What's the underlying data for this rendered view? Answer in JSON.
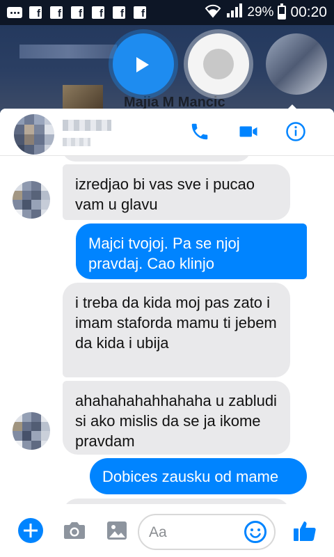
{
  "status_bar": {
    "notification_icons": [
      "messages-icon",
      "facebook-icon",
      "facebook-icon",
      "facebook-icon",
      "facebook-icon",
      "facebook-icon",
      "facebook-icon"
    ],
    "battery_percent": "29%",
    "time": "00:20"
  },
  "background": {
    "contact_name": "Majia M Mancic"
  },
  "chat_header": {
    "call_icon": "phone-icon",
    "video_icon": "video-camera-icon",
    "info_icon": "info-icon"
  },
  "messages": [
    {
      "direction": "incoming",
      "text": "izredjao bi vas sve i pucao vam u glavu"
    },
    {
      "direction": "outgoing",
      "text": "Majci tvojoj. Pa se njoj pravdaj. Cao klinjo"
    },
    {
      "direction": "incoming",
      "text": "i treba da kida moj pas zato i imam staforda mamu ti jebem da kida i ubija"
    },
    {
      "direction": "incoming",
      "text": "ahahahahahhahaha u zabludi si ako mislis da se ja ikome pravdam"
    },
    {
      "direction": "outgoing",
      "text": "Dobices zausku od mame"
    }
  ],
  "composer": {
    "placeholder": "Aa",
    "add_icon": "plus-circle-icon",
    "camera_icon": "camera-icon",
    "gallery_icon": "image-icon",
    "emoji_icon": "smiley-icon",
    "like_icon": "thumbs-up-icon"
  },
  "colors": {
    "accent": "#0084ff",
    "incoming_bubble": "#e9e9eb",
    "status_bar": "#0d1626"
  }
}
